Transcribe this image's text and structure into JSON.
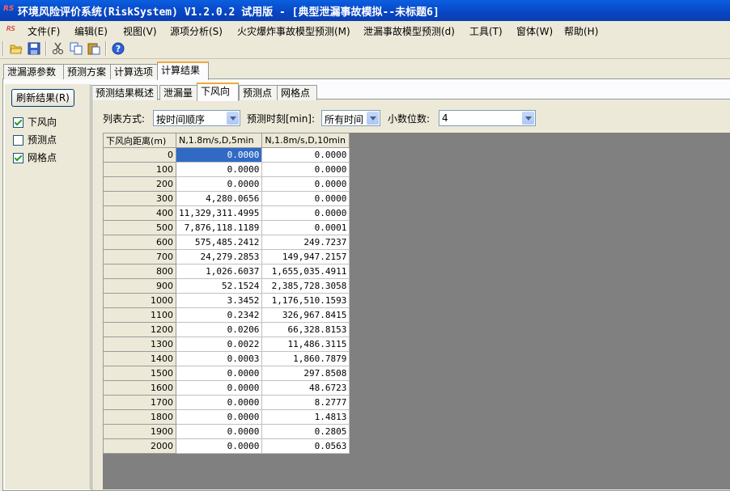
{
  "window": {
    "title": "环境风险评价系统(RiskSystem) V1.2.0.2 试用版 - [典型泄漏事故模拟--未标题6]",
    "app_icon": "RS"
  },
  "menu": [
    {
      "label": "文件(F)"
    },
    {
      "label": "编辑(E)"
    },
    {
      "label": "视图(V)"
    },
    {
      "label": "源项分析(S)"
    },
    {
      "label": "火灾爆炸事故模型预测(M)"
    },
    {
      "label": "泄漏事故模型预测(d)"
    },
    {
      "label": "工具(T)"
    },
    {
      "label": "窗体(W)"
    },
    {
      "label": "帮助(H)"
    }
  ],
  "toolbar": {
    "icons": [
      "open-folder-icon",
      "save-icon",
      "cut-icon",
      "copy-icon",
      "paste-icon",
      "help-icon"
    ]
  },
  "main_tabs": [
    "泄漏源参数",
    "预测方案",
    "计算选项",
    "计算结果"
  ],
  "left_panel": {
    "refresh_label": "刷新结果(R)",
    "checks": [
      {
        "label": "下风向",
        "checked": true
      },
      {
        "label": "预测点",
        "checked": false
      },
      {
        "label": "网格点",
        "checked": true
      }
    ]
  },
  "sub_tabs": [
    "预测结果概述",
    "泄漏量",
    "下风向",
    "预测点",
    "网格点"
  ],
  "options": {
    "list_mode_label": "列表方式:",
    "list_mode_value": "按时间顺序",
    "time_label": "预测时刻[min]:",
    "time_value": "所有时间",
    "decimals_label": "小数位数:",
    "decimals_value": "4"
  },
  "table": {
    "headers": [
      "下风向距离(m)",
      "N,1.8m/s,D,5min",
      "N,1.8m/s,D,10min"
    ],
    "rows": [
      [
        "0",
        "0.0000",
        "0.0000"
      ],
      [
        "100",
        "0.0000",
        "0.0000"
      ],
      [
        "200",
        "0.0000",
        "0.0000"
      ],
      [
        "300",
        "4,280.0656",
        "0.0000"
      ],
      [
        "400",
        "11,329,311.4995",
        "0.0000"
      ],
      [
        "500",
        "7,876,118.1189",
        "0.0001"
      ],
      [
        "600",
        "575,485.2412",
        "249.7237"
      ],
      [
        "700",
        "24,279.2853",
        "149,947.2157"
      ],
      [
        "800",
        "1,026.6037",
        "1,655,035.4911"
      ],
      [
        "900",
        "52.1524",
        "2,385,728.3058"
      ],
      [
        "1000",
        "3.3452",
        "1,176,510.1593"
      ],
      [
        "1100",
        "0.2342",
        "326,967.8415"
      ],
      [
        "1200",
        "0.0206",
        "66,328.8153"
      ],
      [
        "1300",
        "0.0022",
        "11,486.3115"
      ],
      [
        "1400",
        "0.0003",
        "1,860.7879"
      ],
      [
        "1500",
        "0.0000",
        "297.8508"
      ],
      [
        "1600",
        "0.0000",
        "48.6723"
      ],
      [
        "1700",
        "0.0000",
        "8.2777"
      ],
      [
        "1800",
        "0.0000",
        "1.4813"
      ],
      [
        "1900",
        "0.0000",
        "0.2805"
      ],
      [
        "2000",
        "0.0000",
        "0.0563"
      ]
    ]
  }
}
